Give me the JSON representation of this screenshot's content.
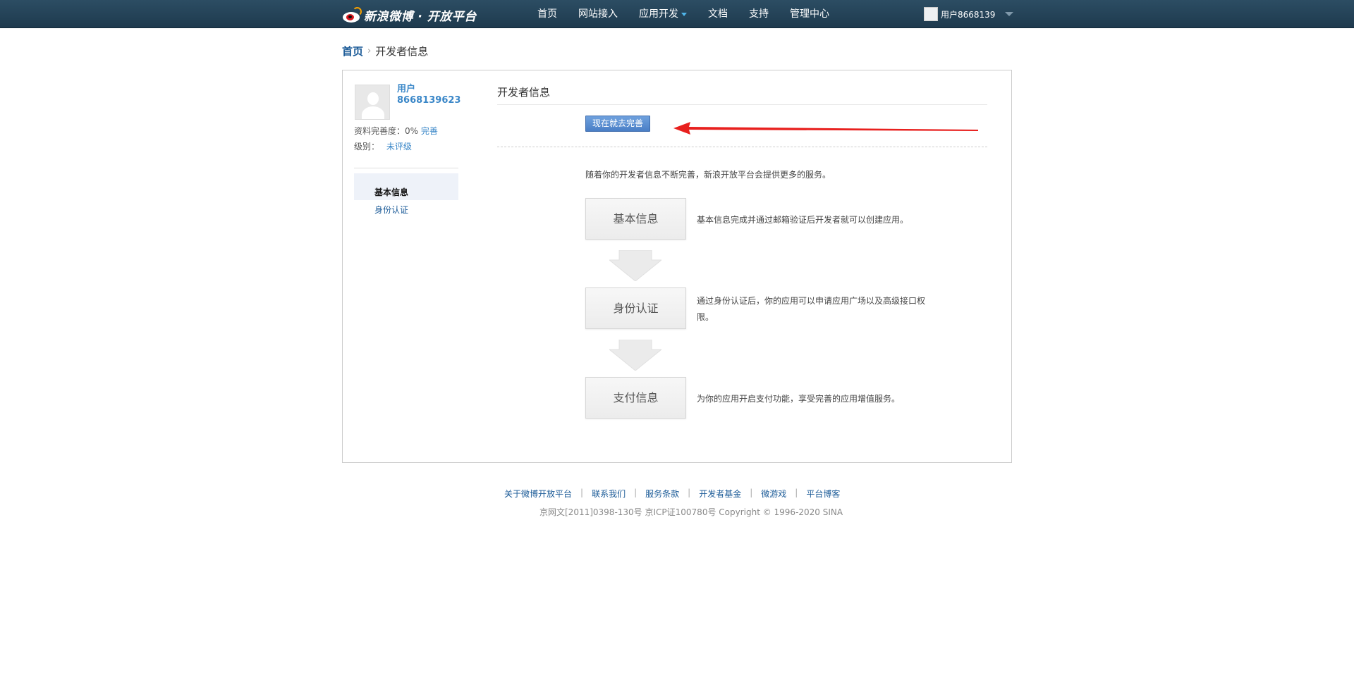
{
  "topbar": {
    "brand": "新浪微博 · 开放平台",
    "nav": [
      {
        "label": "首页"
      },
      {
        "label": "网站接入"
      },
      {
        "label": "应用开发"
      },
      {
        "label": "文档"
      },
      {
        "label": "支持"
      },
      {
        "label": "管理中心"
      }
    ],
    "user_name": "用户8668139"
  },
  "breadcrumb": {
    "home": "首页",
    "current": "开发者信息"
  },
  "sidebar": {
    "username": "用户8668139623",
    "completeness_label": "资料完善度：0%",
    "completeness_link": "完善",
    "level_label": "级别：",
    "level_value": "未评级",
    "menu": [
      {
        "label": "基本信息",
        "active": true
      },
      {
        "label": "身份认证",
        "active": false
      }
    ]
  },
  "main": {
    "title": "开发者信息",
    "complete_button": "现在就去完善",
    "intro": "随着你的开发者信息不断完善，新浪开放平台会提供更多的服务。",
    "steps": [
      {
        "label": "基本信息",
        "desc": "基本信息完成并通过邮箱验证后开发者就可以创建应用。"
      },
      {
        "label": "身份认证",
        "desc": "通过身份认证后，你的应用可以申请应用广场以及高级接口权限。"
      },
      {
        "label": "支付信息",
        "desc": "为你的应用开启支付功能，享受完善的应用增值服务。"
      }
    ]
  },
  "footer": {
    "links": [
      "关于微博开放平台",
      "联系我们",
      "服务条款",
      "开发者基金",
      "微游戏",
      "平台博客"
    ],
    "separator": "|",
    "copyright": "京网文[2011]0398-130号 京ICP证100780号 Copyright © 1996-2020 SINA"
  },
  "colors": {
    "topbar": "#1e3a4e",
    "link": "#3a87c8",
    "button": "#4a7fc6",
    "annotation_arrow": "#e8201e"
  },
  "icons": [
    "weibo-logo-icon",
    "dropdown-caret-icon",
    "avatar-placeholder-icon",
    "breadcrumb-chevron-icon",
    "down-arrow-icon"
  ]
}
